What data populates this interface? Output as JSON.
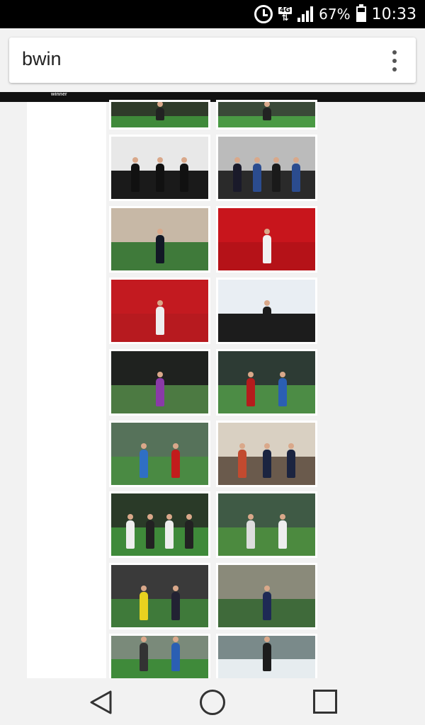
{
  "status_bar": {
    "network": "4G",
    "battery": "67%",
    "time": "10:33",
    "icons": [
      "alarm-icon",
      "network-4g-icon",
      "signal-icon",
      "battery-icon"
    ]
  },
  "browser": {
    "url": "bwin",
    "menu_icon": "more-vert-icon"
  },
  "page": {
    "header_wordmark": "winner"
  },
  "gallery": {
    "rows": [
      [
        {
          "sky": "#2f3b2a",
          "ground": "#3f8a3a",
          "players": [
            {
              "c": "#222"
            }
          ]
        },
        {
          "sky": "#3a4a38",
          "ground": "#4a9a44",
          "players": [
            {
              "c": "#222"
            }
          ]
        }
      ],
      [
        {
          "sky": "#e8e8e8",
          "ground": "#1a1a1a",
          "players": [
            {
              "c": "#111"
            },
            {
              "c": "#111"
            },
            {
              "c": "#111"
            }
          ]
        },
        {
          "sky": "#bbb",
          "ground": "#2a2a2a",
          "players": [
            {
              "c": "#1a1a2a"
            },
            {
              "c": "#2b4c8f"
            },
            {
              "c": "#1a1a1a"
            },
            {
              "c": "#2b4c8f"
            }
          ]
        }
      ],
      [
        {
          "sky": "#c7b8a6",
          "ground": "#3f7a3a",
          "players": [
            {
              "c": "#121826"
            }
          ]
        },
        {
          "sky": "#c8151c",
          "ground": "#b51218",
          "players": [
            {
              "c": "#f1f1f1"
            }
          ]
        }
      ],
      [
        {
          "sky": "#c31a20",
          "ground": "#b71a1f",
          "players": [
            {
              "c": "#eee"
            }
          ]
        },
        {
          "sky": "#e9eef3",
          "ground": "#1c1c1c",
          "players": [
            {
              "c": "#1c1c1c"
            }
          ]
        }
      ],
      [
        {
          "sky": "#1f221f",
          "ground": "#4c7a42",
          "players": [
            {
              "c": "#8a3aa8"
            }
          ]
        },
        {
          "sky": "#2d3b34",
          "ground": "#4c8c45",
          "players": [
            {
              "c": "#b51c1c"
            },
            {
              "c": "#2b5fb3"
            }
          ]
        }
      ],
      [
        {
          "sky": "#56725a",
          "ground": "#4a8a43",
          "players": [
            {
              "c": "#2f6fc4"
            },
            {
              "c": "#c21c1c"
            }
          ]
        },
        {
          "sky": "#d9d0c2",
          "ground": "#6a5a4c",
          "players": [
            {
              "c": "#c24a2f"
            },
            {
              "c": "#1b2440"
            },
            {
              "c": "#1b2440"
            }
          ]
        }
      ],
      [
        {
          "sky": "#2a3a28",
          "ground": "#3f8a3a",
          "players": [
            {
              "c": "#eee"
            },
            {
              "c": "#222"
            },
            {
              "c": "#eee"
            },
            {
              "c": "#222"
            }
          ]
        },
        {
          "sky": "#3f5a45",
          "ground": "#4c8a3f",
          "players": [
            {
              "c": "#ddd"
            },
            {
              "c": "#eee"
            }
          ]
        }
      ],
      [
        {
          "sky": "#3a3a3a",
          "ground": "#3f7a3a",
          "players": [
            {
              "c": "#e8d21f"
            },
            {
              "c": "#223"
            }
          ]
        },
        {
          "sky": "#8a8a7a",
          "ground": "#3f6a3a",
          "players": [
            {
              "c": "#1e2a55"
            }
          ]
        }
      ],
      [
        {
          "sky": "#7a8a7a",
          "ground": "#3f8a3a",
          "players": [
            {
              "c": "#333"
            },
            {
              "c": "#2b5fb3"
            }
          ]
        },
        {
          "sky": "#7a8a8a",
          "ground": "#e6ecef",
          "players": [
            {
              "c": "#1c1c1c"
            }
          ]
        }
      ]
    ]
  },
  "nav": {
    "back_icon": "back-triangle-icon",
    "home_icon": "home-circle-icon",
    "recents_icon": "recents-square-icon"
  }
}
